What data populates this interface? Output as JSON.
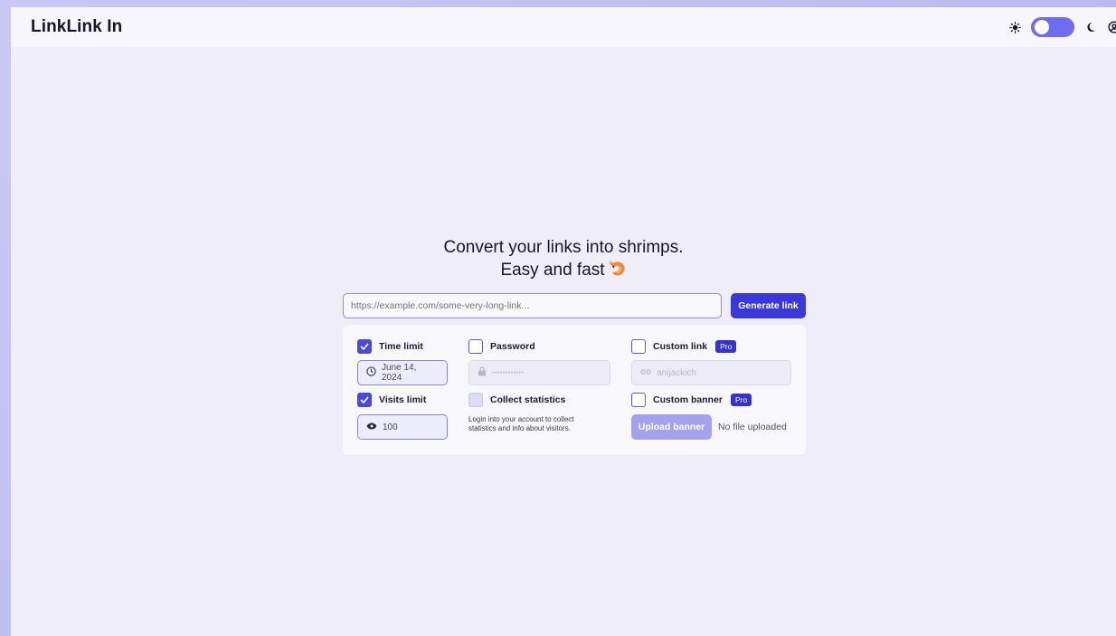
{
  "app": {
    "title": "LinkLink In"
  },
  "header": {
    "theme_toggle": {
      "state": "light"
    },
    "icons": [
      "sun-icon",
      "moon-icon",
      "user-icon"
    ]
  },
  "hero": {
    "line1": "Convert your links into shrimps.",
    "line2": "Easy and fast"
  },
  "url": {
    "placeholder": "https://example.com/some-very-long-link...",
    "value": ""
  },
  "generate_button": {
    "label": "Generate link"
  },
  "options": {
    "time_limit": {
      "label": "Time limit",
      "checked": true,
      "value": "June 14, 2024"
    },
    "visits_limit": {
      "label": "Visits limit",
      "checked": true,
      "value": "100"
    },
    "password": {
      "label": "Password",
      "checked": false,
      "placeholder": "••••••••••••"
    },
    "collect_statistics": {
      "label": "Collect statistics",
      "checked": false,
      "hint_line1": "Login into your account to collect",
      "hint_line2": "statistics and info about visitors."
    },
    "custom_link": {
      "label": "Custom link",
      "badge": "Pro",
      "checked": false,
      "placeholder": "anijackich"
    },
    "custom_banner": {
      "label": "Custom banner",
      "badge": "Pro",
      "checked": false,
      "upload_label": "Upload banner",
      "file_status": "No file uploaded"
    }
  },
  "colors": {
    "accent": "#3b38d9",
    "background": "#eeedf8",
    "outer_background": "#b3b1ee"
  }
}
